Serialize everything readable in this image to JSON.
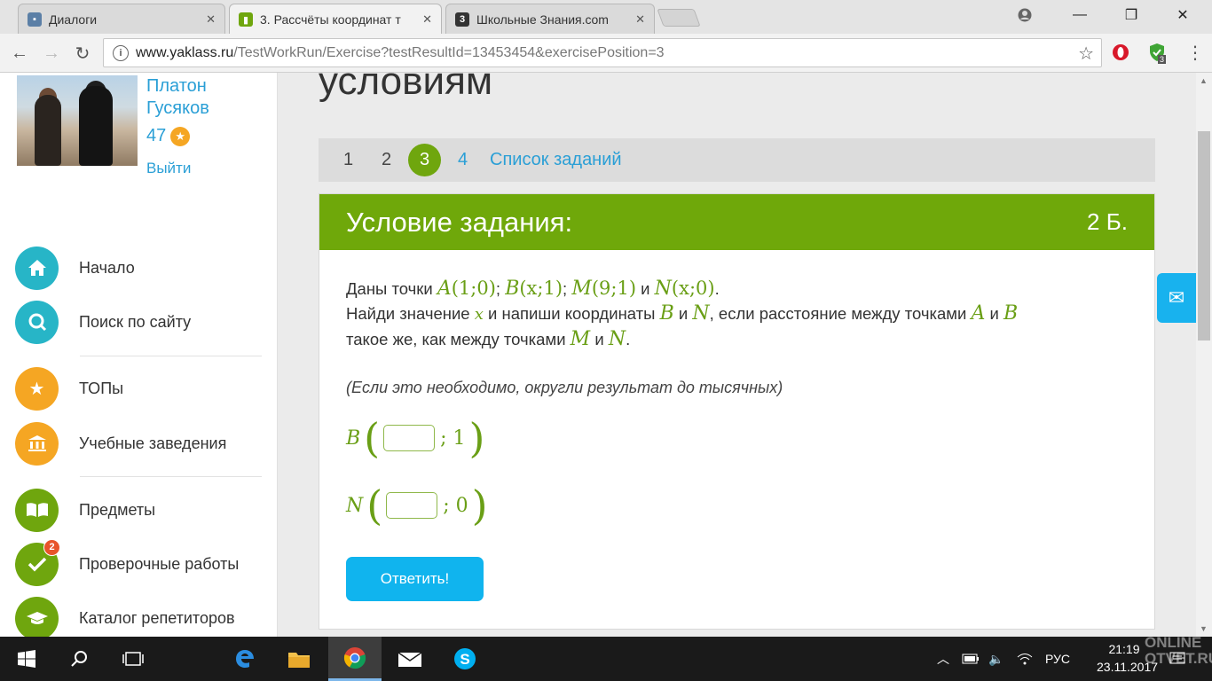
{
  "browser": {
    "tabs": [
      {
        "title": "Диалоги",
        "icon": "vk-icon",
        "close": "✕"
      },
      {
        "title": "3. Рассчёты координат т",
        "icon": "yaklass-icon",
        "close": "✕"
      },
      {
        "title": "Школьные Знания.com",
        "icon": "znanija-icon",
        "close": "✕"
      }
    ],
    "url_host": "www.yaklass.ru",
    "url_path": "/TestWorkRun/Exercise?testResultId=13453454&exercisePosition=3",
    "extension_badge": "3"
  },
  "user": {
    "name": "Платон Гусяков",
    "points": "47",
    "logout": "Выйти"
  },
  "menu": [
    {
      "label": "Начало",
      "icon": "home-icon",
      "color": "#27b5c7"
    },
    {
      "label": "Поиск по сайту",
      "icon": "search-icon",
      "color": "#27b5c7"
    },
    {
      "label": "ТОПы",
      "icon": "star-icon",
      "color": "#f5a623"
    },
    {
      "label": "Учебные заведения",
      "icon": "school-icon",
      "color": "#f5a623"
    },
    {
      "label": "Предметы",
      "icon": "book-icon",
      "color": "#6fa60e"
    },
    {
      "label": "Проверочные работы",
      "icon": "check-icon",
      "color": "#6fa60e",
      "badge": "2"
    },
    {
      "label": "Каталог репетиторов",
      "icon": "graduation-cap-icon",
      "color": "#6fa60e"
    }
  ],
  "main": {
    "heading": "условиям",
    "pager": [
      "1",
      "2",
      "3",
      "4"
    ],
    "current_page": "3",
    "task_list": "Список заданий",
    "card_title": "Условие задания:",
    "card_points": "2 Б.",
    "task": {
      "t1": "Даны точки",
      "pA": "A",
      "cA": "(1;0)",
      "pB": "B",
      "cB": "(x;1)",
      "pM": "M",
      "cM": "(9;1)",
      "and": "и",
      "pN": "N",
      "cN": "(x;0)",
      "t2": "Найди значение",
      "x": "x",
      "t3": "и напиши координаты",
      "t4": ", если расстояние между точками",
      "t5": "такое же, как между точками"
    },
    "hint": "(Если это необходимо, округли результат до тысячных)",
    "answer_B": {
      "label": "B",
      "rest": "; 1",
      "value": ""
    },
    "answer_N": {
      "label": "N",
      "rest": "; 0",
      "value": ""
    },
    "submit": "Ответить!"
  },
  "taskbar": {
    "lang": "РУС",
    "time": "21:19",
    "date": "23.11.2017"
  },
  "watermark": "ONLINE OTVET.RU"
}
